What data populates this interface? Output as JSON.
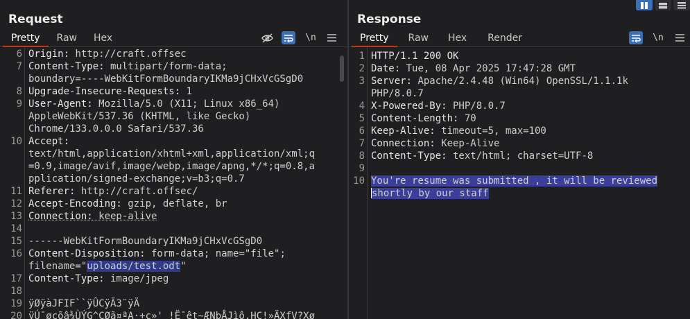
{
  "request": {
    "title": "Request",
    "tabs": [
      "Pretty",
      "Raw",
      "Hex"
    ],
    "tools": {
      "hide": "eye-off",
      "wrap": "wrap",
      "newline": "\\n",
      "menu": "≡"
    },
    "lines": [
      {
        "n": "6",
        "k": "Origin:",
        "v": " http://craft.offsec"
      },
      {
        "n": "7",
        "k": "Content-Type:",
        "v": " multipart/form-data;"
      },
      {
        "n": "",
        "k": "",
        "v": "boundary=----WebKitFormBoundaryIKMa9jCHxVcGSgD0"
      },
      {
        "n": "8",
        "k": "Upgrade-Insecure-Requests:",
        "v": " 1"
      },
      {
        "n": "9",
        "k": "User-Agent:",
        "v": " Mozilla/5.0 (X11; Linux x86_64)"
      },
      {
        "n": "",
        "k": "",
        "v": "AppleWebKit/537.36 (KHTML, like Gecko)"
      },
      {
        "n": "",
        "k": "",
        "v": "Chrome/133.0.0.0 Safari/537.36"
      },
      {
        "n": "10",
        "k": "Accept:",
        "v": ""
      },
      {
        "n": "",
        "k": "",
        "v": "text/html,application/xhtml+xml,application/xml;q"
      },
      {
        "n": "",
        "k": "",
        "v": "=0.9,image/avif,image/webp,image/apng,*/*;q=0.8,a"
      },
      {
        "n": "",
        "k": "",
        "v": "pplication/signed-exchange;v=b3;q=0.7"
      },
      {
        "n": "11",
        "k": "Referer:",
        "v": " http://craft.offsec/"
      },
      {
        "n": "12",
        "k": "Accept-Encoding:",
        "v": " gzip, deflate, br"
      },
      {
        "n": "13",
        "k": "Connection:",
        "v": " keep-alive"
      },
      {
        "n": "14",
        "k": "",
        "v": ""
      },
      {
        "n": "15",
        "k": "",
        "v": "------WebKitFormBoundaryIKMa9jCHxVcGSgD0"
      },
      {
        "n": "16",
        "k": "Content-Disposition:",
        "v": " form-data; name=\"file\";"
      },
      {
        "n": "",
        "k": "",
        "v": "filename=\"uploads/test.odt\""
      },
      {
        "n": "17",
        "k": "Content-Type:",
        "v": " image/jpeg"
      },
      {
        "n": "18",
        "k": "",
        "v": ""
      },
      {
        "n": "19",
        "k": "",
        "v": "ÿØÿàJFIF``ÿÛCÿÃ3¨ÿÄ"
      },
      {
        "n": "20",
        "k": "",
        "v": "ÿÚ¯øcõâ¾ÙÝG^CØã¤ªA·+c»'¸!Ë¯êt~ÆNbÅJìô,HC!»ÄXfV?Xø"
      }
    ],
    "highlight": "uploads/test.odt"
  },
  "response": {
    "title": "Response",
    "tabs": [
      "Pretty",
      "Raw",
      "Hex",
      "Render"
    ],
    "tools": {
      "wrap": "wrap",
      "newline": "\\n",
      "menu": "≡"
    },
    "lines": [
      {
        "n": "1",
        "k": "HTTP/1.1 200 OK",
        "v": ""
      },
      {
        "n": "2",
        "k": "Date:",
        "v": " Tue, 08 Apr 2025 17:47:28 GMT"
      },
      {
        "n": "3",
        "k": "Server:",
        "v": " Apache/2.4.48 (Win64) OpenSSL/1.1.1k"
      },
      {
        "n": "",
        "k": "",
        "v": "PHP/8.0.7"
      },
      {
        "n": "4",
        "k": "X-Powered-By:",
        "v": " PHP/8.0.7"
      },
      {
        "n": "5",
        "k": "Content-Length:",
        "v": " 70"
      },
      {
        "n": "6",
        "k": "Keep-Alive:",
        "v": " timeout=5, max=100"
      },
      {
        "n": "7",
        "k": "Connection:",
        "v": " Keep-Alive"
      },
      {
        "n": "8",
        "k": "Content-Type:",
        "v": " text/html; charset=UTF-8"
      },
      {
        "n": "9",
        "k": "",
        "v": ""
      },
      {
        "n": "10",
        "k": "",
        "v": "You're resume was submitted , it will be reviewed"
      },
      {
        "n": "",
        "k": "",
        "v": "shortly by our staff"
      }
    ]
  },
  "colors": {
    "accent": "#e8643c",
    "toggle": "#3d6fb6",
    "selection": "#3b3f9a",
    "background": "#1f1f22"
  }
}
